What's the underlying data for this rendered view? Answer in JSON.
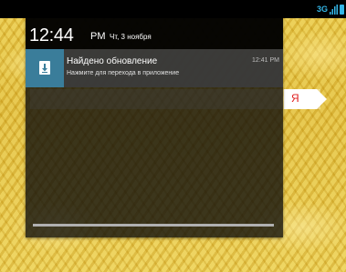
{
  "status_bar": {
    "network_type": "3G",
    "signal_icon": "signal-bars-icon",
    "battery_icon": "battery-icon",
    "accent_color": "#33b5e5"
  },
  "shade": {
    "clock": "12:44",
    "ampm": "PM",
    "date": "Чт, 3 ноября"
  },
  "notification": {
    "icon": "download-icon",
    "icon_bg": "#3a7d9a",
    "title": "Найдено обновление",
    "text": "Нажмите для перехода в приложение",
    "time": "12:41 PM"
  },
  "search_widget": {
    "brand_letter": "Я",
    "brand_color": "#e02020"
  }
}
